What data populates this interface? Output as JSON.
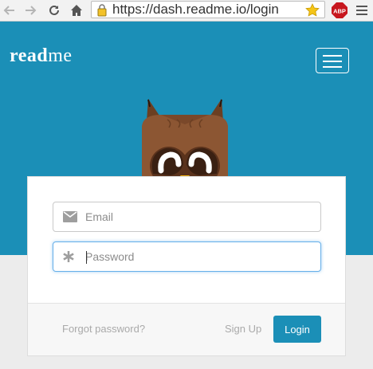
{
  "browser": {
    "url": "https://dash.readme.io/login",
    "adblock_label": "ABP"
  },
  "header": {
    "logo_bold": "read",
    "logo_light": "me",
    "background_color": "#1b8fb7"
  },
  "form": {
    "email_placeholder": "Email",
    "password_placeholder": "Password",
    "forgot_label": "Forgot password?",
    "signup_label": "Sign Up",
    "login_label": "Login",
    "accent_color": "#1b8fb7"
  }
}
